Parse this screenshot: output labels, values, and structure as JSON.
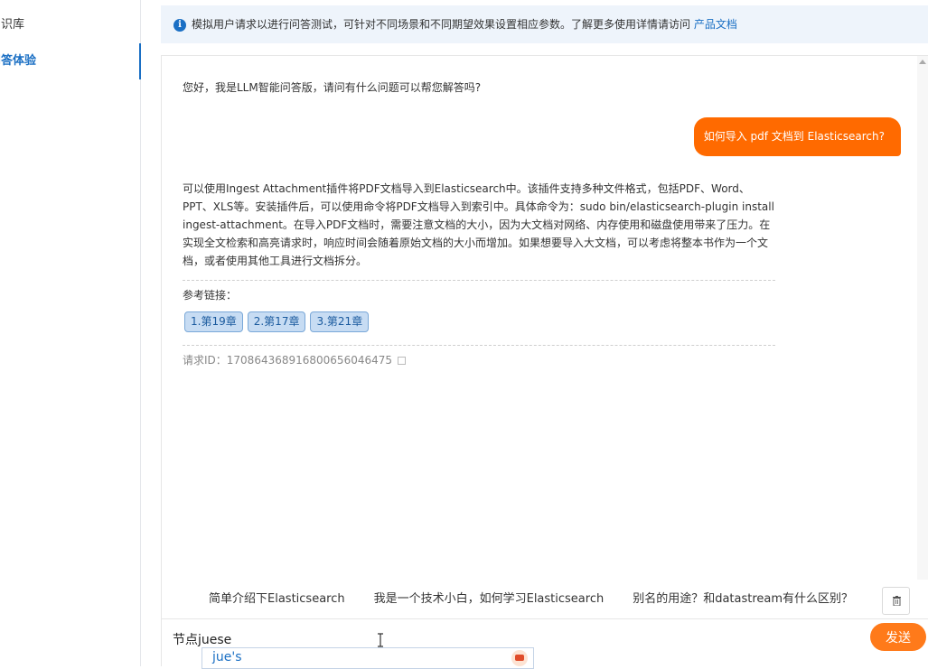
{
  "sidebar": {
    "items": [
      {
        "label": "知识库",
        "active": false
      },
      {
        "label": "问答体验",
        "active": true
      }
    ]
  },
  "notice": {
    "text": "模拟用户请求以进行问答测试，可针对不同场景和不同期望效果设置相应参数。了解更多使用详情请访问",
    "link": "产品文档"
  },
  "chat": {
    "greeting": "您好，我是LLM智能问答版，请问有什么问题可以帮您解答吗?",
    "user_message": "如何导入 pdf 文档到 Elasticsearch?",
    "answer": "可以使用Ingest Attachment插件将PDF文档导入到Elasticsearch中。该插件支持多种文件格式，包括PDF、Word、PPT、XLS等。安装插件后，可以使用命令将PDF文档导入到索引中。具体命令为：sudo bin/elasticsearch-plugin install ingest-attachment。在导入PDF文档时，需要注意文档的大小，因为大文档对网络、内存使用和磁盘使用带来了压力。在实现全文检索和高亮请求时，响应时间会随着原始文档的大小而增加。如果想要导入大文档，可以考虑将整本书作为一个文档，或者使用其他工具进行文档拆分。",
    "ref_label": "参考链接：",
    "refs": [
      "1.第19章",
      "2.第17章",
      "3.第21章"
    ],
    "request_id": "请求ID：17086436891680065604647​5"
  },
  "suggestions": [
    "简单介绍下Elasticsearch",
    "我是一个技术小白，如何学习Elasticsearch",
    "别名的用途？和datastream有什么区别？"
  ],
  "input": {
    "value": "节点juese",
    "send_label": "发送",
    "ime_candidate": "jue's"
  },
  "colors": {
    "accent": "#ff6a00",
    "link": "#1a6fc4"
  }
}
